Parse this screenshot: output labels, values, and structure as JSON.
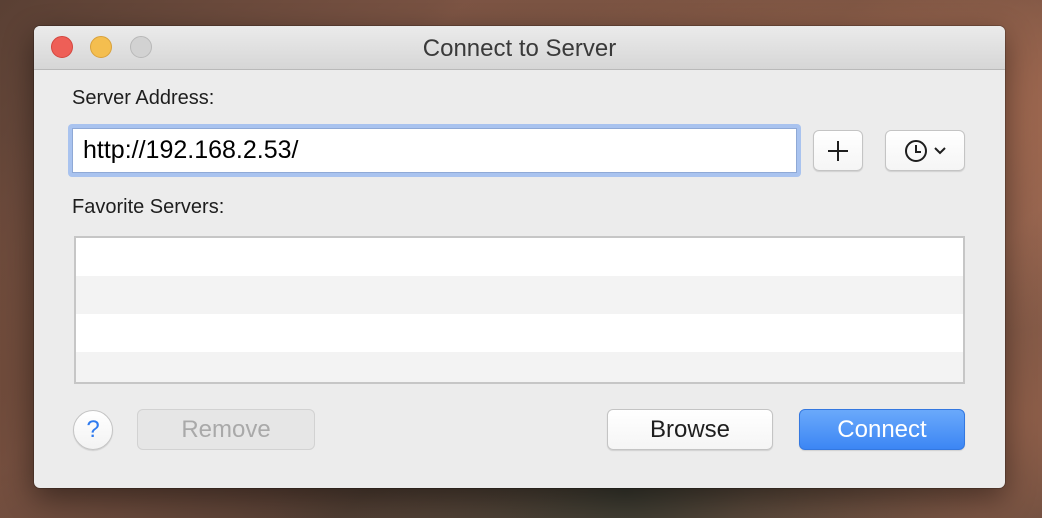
{
  "window": {
    "title": "Connect to Server"
  },
  "form": {
    "server_address_label": "Server Address:",
    "server_address_value": "http://192.168.2.53/",
    "favorite_servers_label": "Favorite Servers:",
    "favorite_servers": []
  },
  "buttons": {
    "add_icon": "plus-icon",
    "recent_icon": "clock-icon",
    "help_label": "?",
    "remove_label": "Remove",
    "browse_label": "Browse",
    "connect_label": "Connect"
  },
  "colors": {
    "accent": "#3c86f4",
    "close": "#ee5f57",
    "minimize": "#f4be4f",
    "zoom_disabled": "#d2d2d2",
    "focus_ring": "#a9c3ef"
  }
}
